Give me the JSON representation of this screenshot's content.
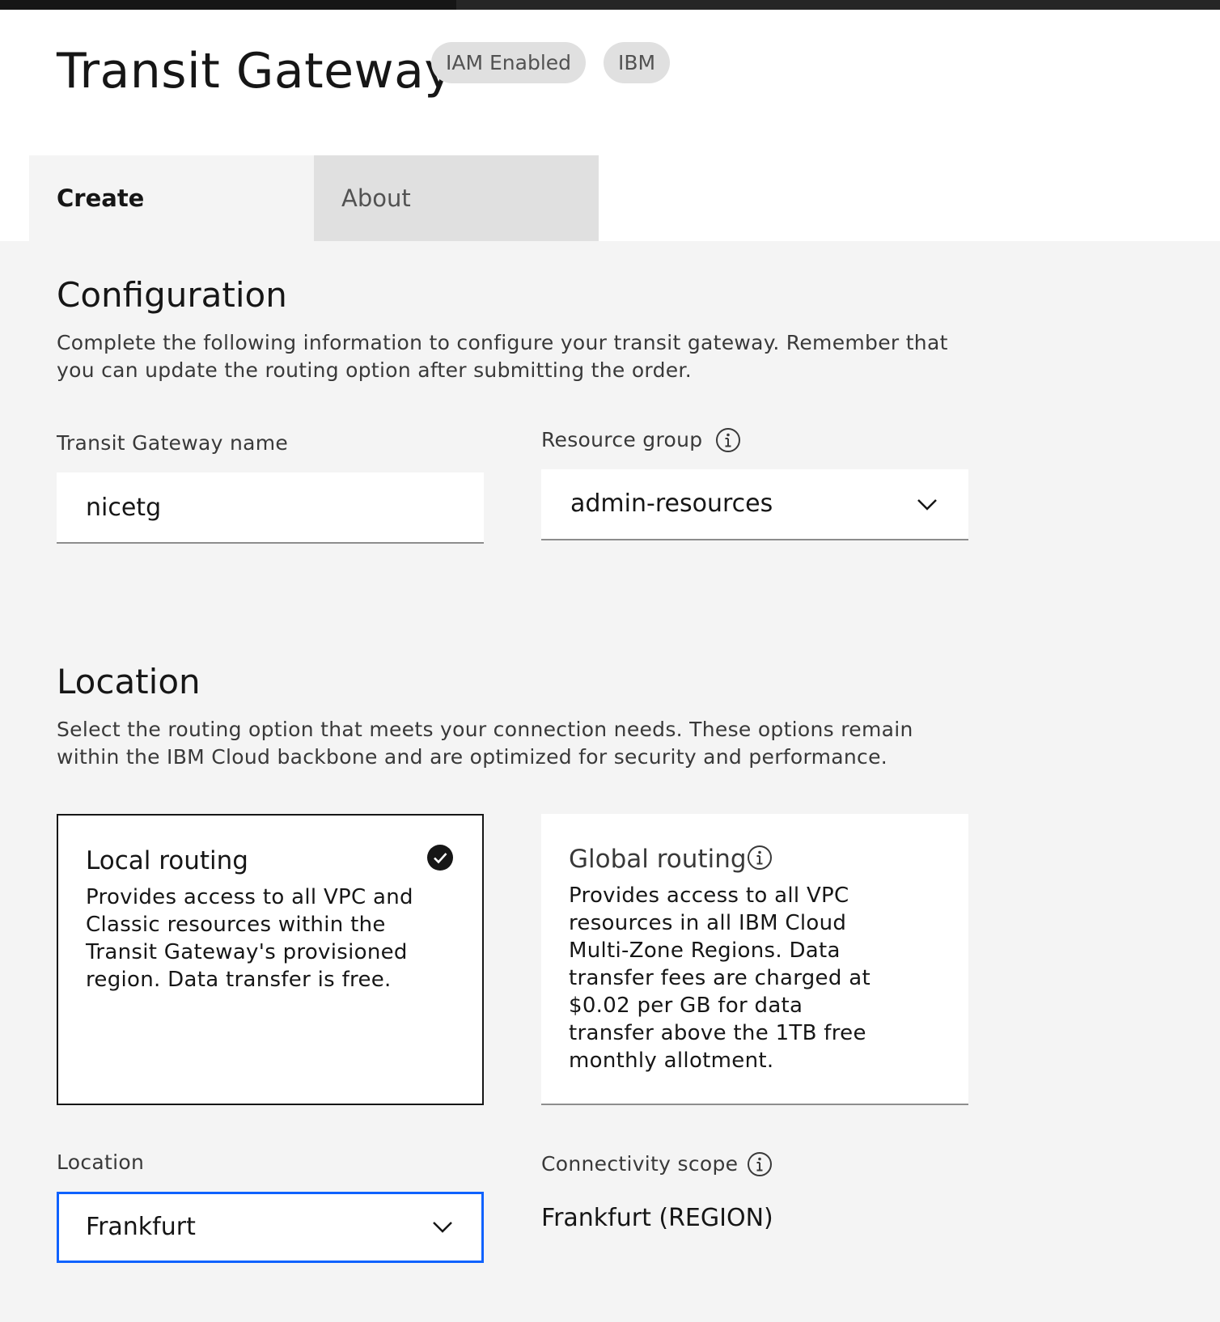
{
  "header": {
    "title": "Transit Gateway",
    "tags": [
      "IAM Enabled",
      "IBM"
    ]
  },
  "tabs": [
    {
      "label": "Create",
      "active": true
    },
    {
      "label": "About",
      "active": false
    }
  ],
  "configuration": {
    "title": "Configuration",
    "description": "Complete the following information to configure your transit gateway. Remember that you can update the routing option after submitting the order.",
    "name_field": {
      "label": "Transit Gateway name",
      "value": "nicetg"
    },
    "resource_group": {
      "label": "Resource group",
      "value": "admin-resources"
    }
  },
  "location_section": {
    "title": "Location",
    "description": "Select the routing option that meets your connection needs. These options remain within the IBM Cloud backbone and are optimized for security and performance.",
    "routing_options": [
      {
        "title": "Local routing",
        "description": "Provides access to all VPC and Classic resources within the Transit Gateway's provisioned region. Data transfer is free.",
        "selected": true
      },
      {
        "title": "Global routing",
        "description": "Provides access to all VPC resources in all IBM Cloud Multi-Zone Regions. Data transfer fees are charged at $0.02 per GB for data transfer above the 1TB free monthly allotment.",
        "selected": false
      }
    ],
    "location_field": {
      "label": "Location",
      "value": "Frankfurt"
    },
    "connectivity_scope": {
      "label": "Connectivity scope",
      "value": "Frankfurt (REGION)"
    }
  },
  "colors": {
    "focus": "#0f62fe",
    "tag_bg": "#e0e0e0",
    "content_bg": "#f4f4f4"
  }
}
